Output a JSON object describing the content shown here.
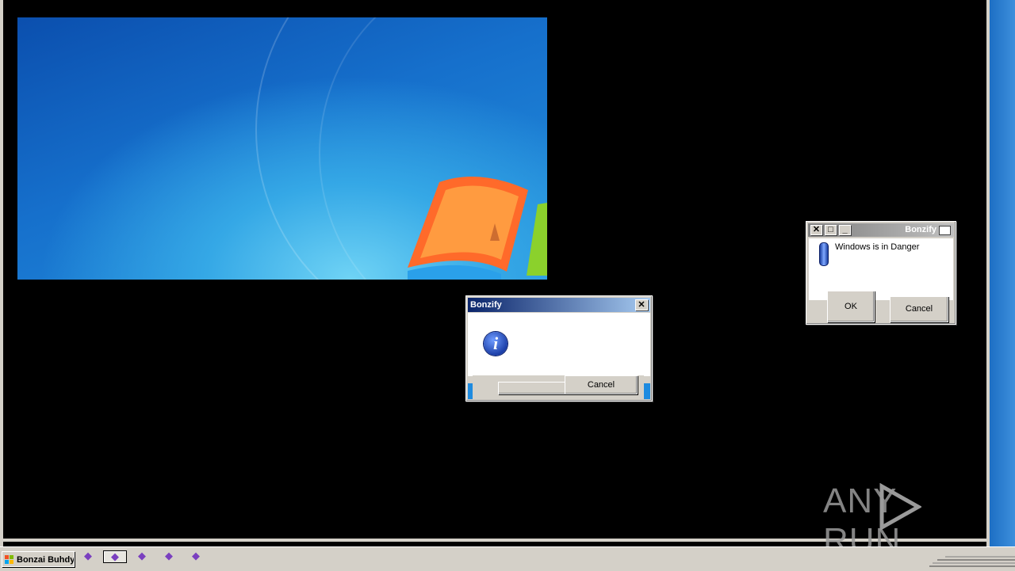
{
  "dialog_main": {
    "title": "Bonzify",
    "close_glyph": "✕",
    "ok_label": "",
    "cancel_label": "Cancel",
    "icon": "info-icon"
  },
  "dialog_small": {
    "title": "Bonzify",
    "message": "Windows is in Danger",
    "ok_label": "OK",
    "cancel_label": "Cancel",
    "icon": "bonzi-icon"
  },
  "taskbar": {
    "start_label": "Bonzai Buhdy",
    "tray_icons": [
      "purple-gorilla-icon",
      "purple-gorilla-icon",
      "purple-gorilla-icon",
      "purple-gorilla-icon",
      "purple-gorilla-icon"
    ]
  },
  "watermark": {
    "left_text": "ANY",
    "right_text": "RUN"
  }
}
